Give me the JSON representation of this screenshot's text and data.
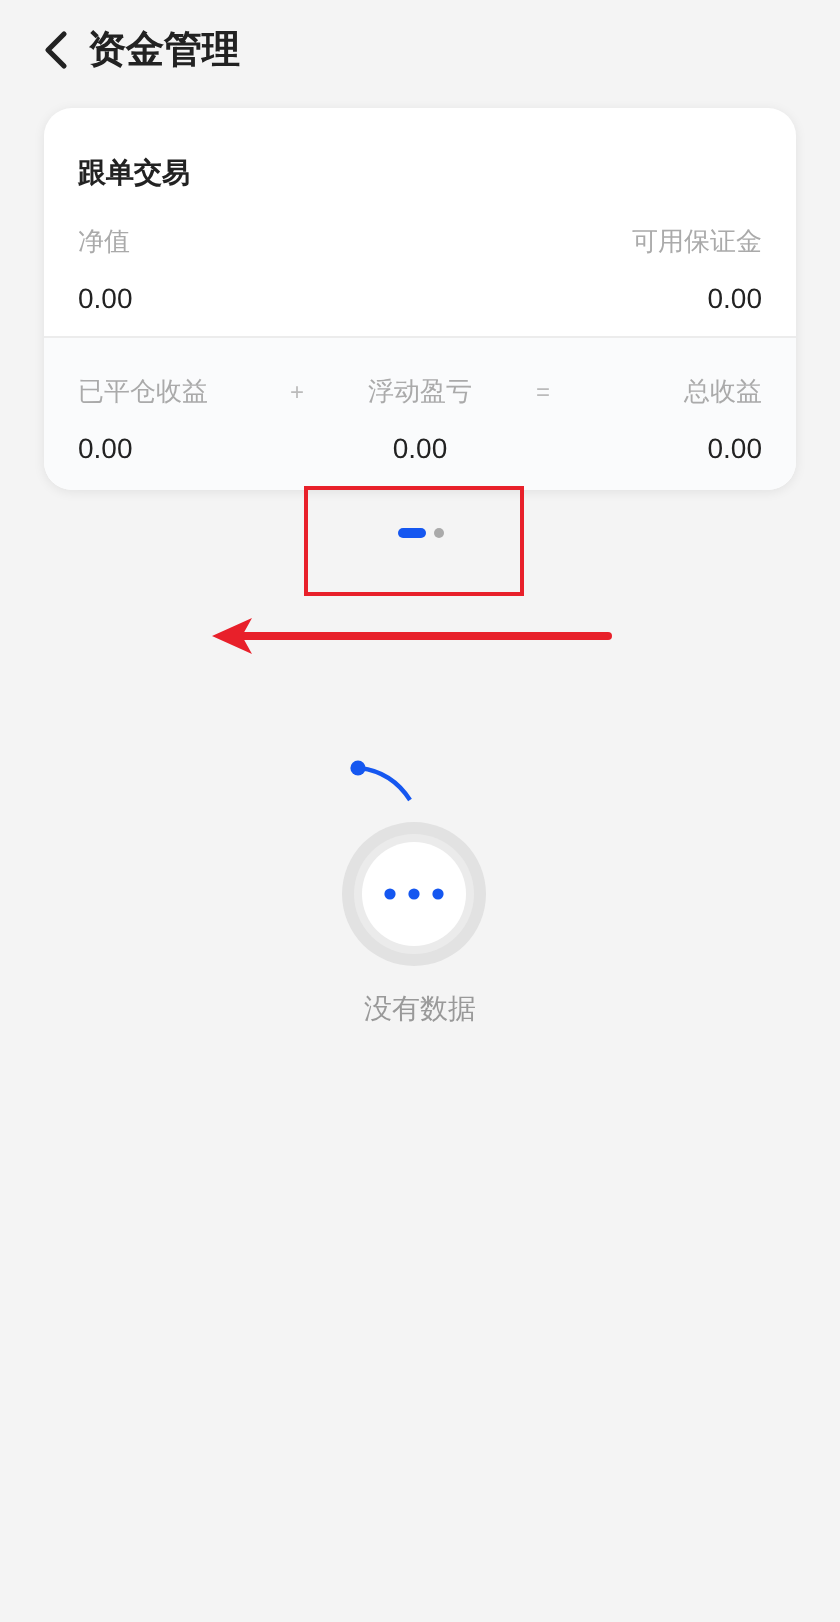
{
  "header": {
    "title": "资金管理"
  },
  "card": {
    "title": "跟单交易",
    "top_row": [
      {
        "label": "净值",
        "value": "0.00"
      },
      {
        "label": "可用保证金",
        "value": "0.00"
      }
    ],
    "bottom_row": [
      {
        "kind": "stat",
        "label": "已平仓收益",
        "value": "0.00"
      },
      {
        "kind": "operator",
        "symbol": "+"
      },
      {
        "kind": "stat",
        "label": "浮动盈亏",
        "value": "0.00"
      },
      {
        "kind": "operator",
        "symbol": "="
      },
      {
        "kind": "stat",
        "label": "总收益",
        "value": "0.00"
      }
    ]
  },
  "pager": [
    {
      "selected": true
    },
    {
      "selected": false
    }
  ],
  "empty_state": {
    "message": "没有数据"
  }
}
